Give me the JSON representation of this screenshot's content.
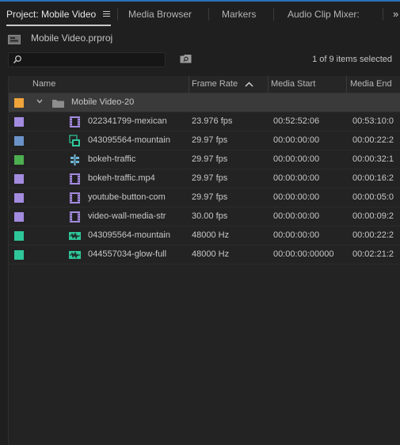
{
  "tabs": [
    {
      "label": "Project: Mobile Video"
    },
    {
      "label": "Media Browser"
    },
    {
      "label": "Markers"
    },
    {
      "label": "Audio Clip Mixer:"
    }
  ],
  "project": {
    "file_name": "Mobile Video.prproj"
  },
  "search": {
    "value": "",
    "placeholder": ""
  },
  "status": {
    "selection_text": "1 of 9 items selected"
  },
  "columns": {
    "name": "Name",
    "frame_rate": "Frame Rate",
    "media_start": "Media Start",
    "media_end": "Media End"
  },
  "colors": {
    "folder_label": "#f0a43a",
    "violet_label": "#a38be0",
    "blue_label": "#6b93c9",
    "green_label": "#4caf50",
    "teal_label": "#2ec79a"
  },
  "folder": {
    "name": "Mobile Video-20",
    "label_color": "#f0a43a"
  },
  "items": [
    {
      "name": "022341799-mexican",
      "frame_rate": "23.976 fps",
      "media_start": "00:52:52:06",
      "media_end": "00:53:10:0",
      "icon": "video-clip-icon",
      "label_color": "#a38be0"
    },
    {
      "name": "043095564-mountain",
      "frame_rate": "29.97 fps",
      "media_start": "00:00:00:00",
      "media_end": "00:00:22:2",
      "icon": "sequence-icon",
      "label_color": "#6b93c9"
    },
    {
      "name": "bokeh-traffic",
      "frame_rate": "29.97 fps",
      "media_start": "00:00:00:00",
      "media_end": "00:00:32:1",
      "icon": "multicam-icon",
      "label_color": "#4caf50"
    },
    {
      "name": "bokeh-traffic.mp4",
      "frame_rate": "29.97 fps",
      "media_start": "00:00:00:00",
      "media_end": "00:00:16:2",
      "icon": "video-clip-icon",
      "label_color": "#a38be0"
    },
    {
      "name": "youtube-button-com",
      "frame_rate": "29.97 fps",
      "media_start": "00:00:00:00",
      "media_end": "00:00:05:0",
      "icon": "video-clip-icon",
      "label_color": "#a38be0"
    },
    {
      "name": "video-wall-media-str",
      "frame_rate": "30.00 fps",
      "media_start": "00:00:00:00",
      "media_end": "00:00:09:2",
      "icon": "video-clip-icon",
      "label_color": "#a38be0"
    },
    {
      "name": "043095564-mountain",
      "frame_rate": "48000 Hz",
      "media_start": "00:00:00:00",
      "media_end": "00:00:22:2",
      "icon": "audio-clip-icon",
      "label_color": "#2ec79a"
    },
    {
      "name": "044557034-glow-full",
      "frame_rate": "48000 Hz",
      "media_start": "00:00:00:00000",
      "media_end": "00:02:21:2",
      "icon": "audio-clip-icon",
      "label_color": "#2ec79a"
    }
  ]
}
